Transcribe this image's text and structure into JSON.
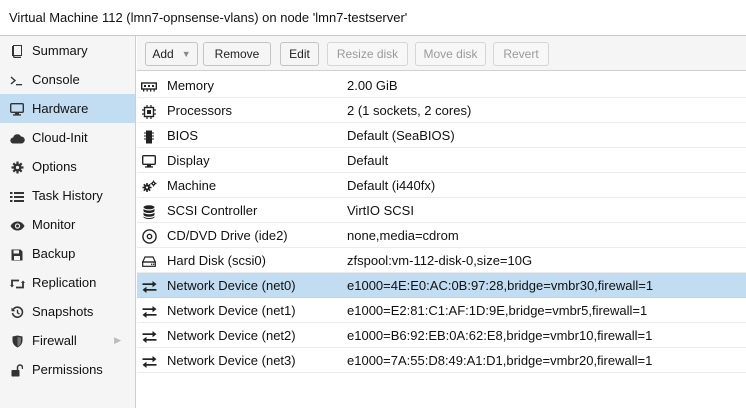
{
  "window": {
    "title": "Virtual Machine 112 (lmn7-opnsense-vlans) on node 'lmn7-testserver'"
  },
  "sidebar": {
    "items": [
      {
        "label": "Summary",
        "icon": "book-icon",
        "selected": false
      },
      {
        "label": "Console",
        "icon": "terminal-icon",
        "selected": false
      },
      {
        "label": "Hardware",
        "icon": "desktop-icon",
        "selected": true
      },
      {
        "label": "Cloud-Init",
        "icon": "cloud-icon",
        "selected": false
      },
      {
        "label": "Options",
        "icon": "gear-icon",
        "selected": false
      },
      {
        "label": "Task History",
        "icon": "list-icon",
        "selected": false
      },
      {
        "label": "Monitor",
        "icon": "eye-icon",
        "selected": false
      },
      {
        "label": "Backup",
        "icon": "floppy-icon",
        "selected": false
      },
      {
        "label": "Replication",
        "icon": "retweet-icon",
        "selected": false
      },
      {
        "label": "Snapshots",
        "icon": "history-icon",
        "selected": false
      },
      {
        "label": "Firewall",
        "icon": "shield-icon",
        "selected": false
      },
      {
        "label": "Permissions",
        "icon": "unlock-icon",
        "selected": false
      }
    ]
  },
  "toolbar": {
    "add_label": "Add",
    "remove_label": "Remove",
    "edit_label": "Edit",
    "resize_label": "Resize disk",
    "move_label": "Move disk",
    "revert_label": "Revert"
  },
  "hardware": {
    "rows": [
      {
        "name": "Memory",
        "value": "2.00 GiB",
        "icon": "memory-icon",
        "selected": false
      },
      {
        "name": "Processors",
        "value": "2 (1 sockets, 2 cores)",
        "icon": "cpu-icon",
        "selected": false
      },
      {
        "name": "BIOS",
        "value": "Default (SeaBIOS)",
        "icon": "microchip-icon",
        "selected": false
      },
      {
        "name": "Display",
        "value": "Default",
        "icon": "desktop-icon",
        "selected": false
      },
      {
        "name": "Machine",
        "value": "Default (i440fx)",
        "icon": "cogs-icon",
        "selected": false
      },
      {
        "name": "SCSI Controller",
        "value": "VirtIO SCSI",
        "icon": "database-icon",
        "selected": false
      },
      {
        "name": "CD/DVD Drive (ide2)",
        "value": "none,media=cdrom",
        "icon": "cdrom-icon",
        "selected": false
      },
      {
        "name": "Hard Disk (scsi0)",
        "value": "zfspool:vm-112-disk-0,size=10G",
        "icon": "hdd-icon",
        "selected": false
      },
      {
        "name": "Network Device (net0)",
        "value": "e1000=4E:E0:AC:0B:97:28,bridge=vmbr30,firewall=1",
        "icon": "exchange-icon",
        "selected": true
      },
      {
        "name": "Network Device (net1)",
        "value": "e1000=E2:81:C1:AF:1D:9E,bridge=vmbr5,firewall=1",
        "icon": "exchange-icon",
        "selected": false
      },
      {
        "name": "Network Device (net2)",
        "value": "e1000=B6:92:EB:0A:62:E8,bridge=vmbr10,firewall=1",
        "icon": "exchange-icon",
        "selected": false
      },
      {
        "name": "Network Device (net3)",
        "value": "e1000=7A:55:D8:49:A1:D1,bridge=vmbr20,firewall=1",
        "icon": "exchange-icon",
        "selected": false
      }
    ]
  },
  "colors": {
    "selection": "#c2ddf2",
    "sidebar_bg": "#f5f5f5",
    "toolbar_bg": "#f5f5f5"
  }
}
